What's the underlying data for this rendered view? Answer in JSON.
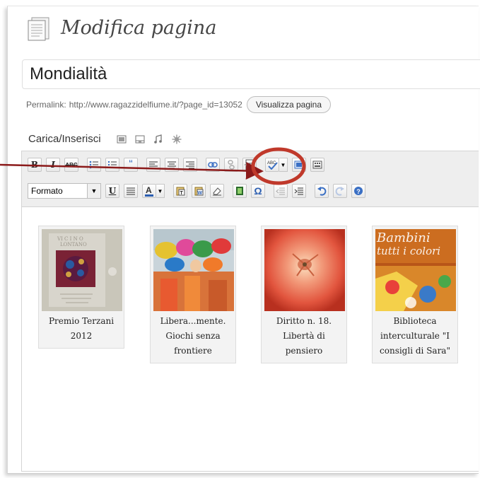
{
  "header": {
    "title": "Modifica pagina"
  },
  "post": {
    "title": "Mondialità"
  },
  "permalink": {
    "label": "Permalink:",
    "url": "http://www.ragazzidelfiume.it/?page_id=13052",
    "view_button": "Visualizza pagina"
  },
  "media": {
    "label": "Carica/Inserisci"
  },
  "toolbar": {
    "format_label": "Formato",
    "text_color_accent": "#2a5db0"
  },
  "gallery": {
    "items": [
      {
        "caption_line1": "Premio Terzani",
        "caption_line2": "2012",
        "caption_line3": ""
      },
      {
        "caption_line1": "Libera...mente.",
        "caption_line2": "Giochi senza",
        "caption_line3": "frontiere"
      },
      {
        "caption_line1": "Diritto n. 18.",
        "caption_line2": "Libertà di pensiero",
        "caption_line3": ""
      },
      {
        "caption_line1": "Biblioteca",
        "caption_line2": "interculturale \"I",
        "caption_line3": "consigli di Sara\""
      }
    ],
    "book_cover_text": {
      "line1": "Bambini",
      "line2": "tutti i colori"
    }
  },
  "annotation": {
    "circle_color": "#c0392b",
    "arrow_color": "#8b1a1a"
  }
}
